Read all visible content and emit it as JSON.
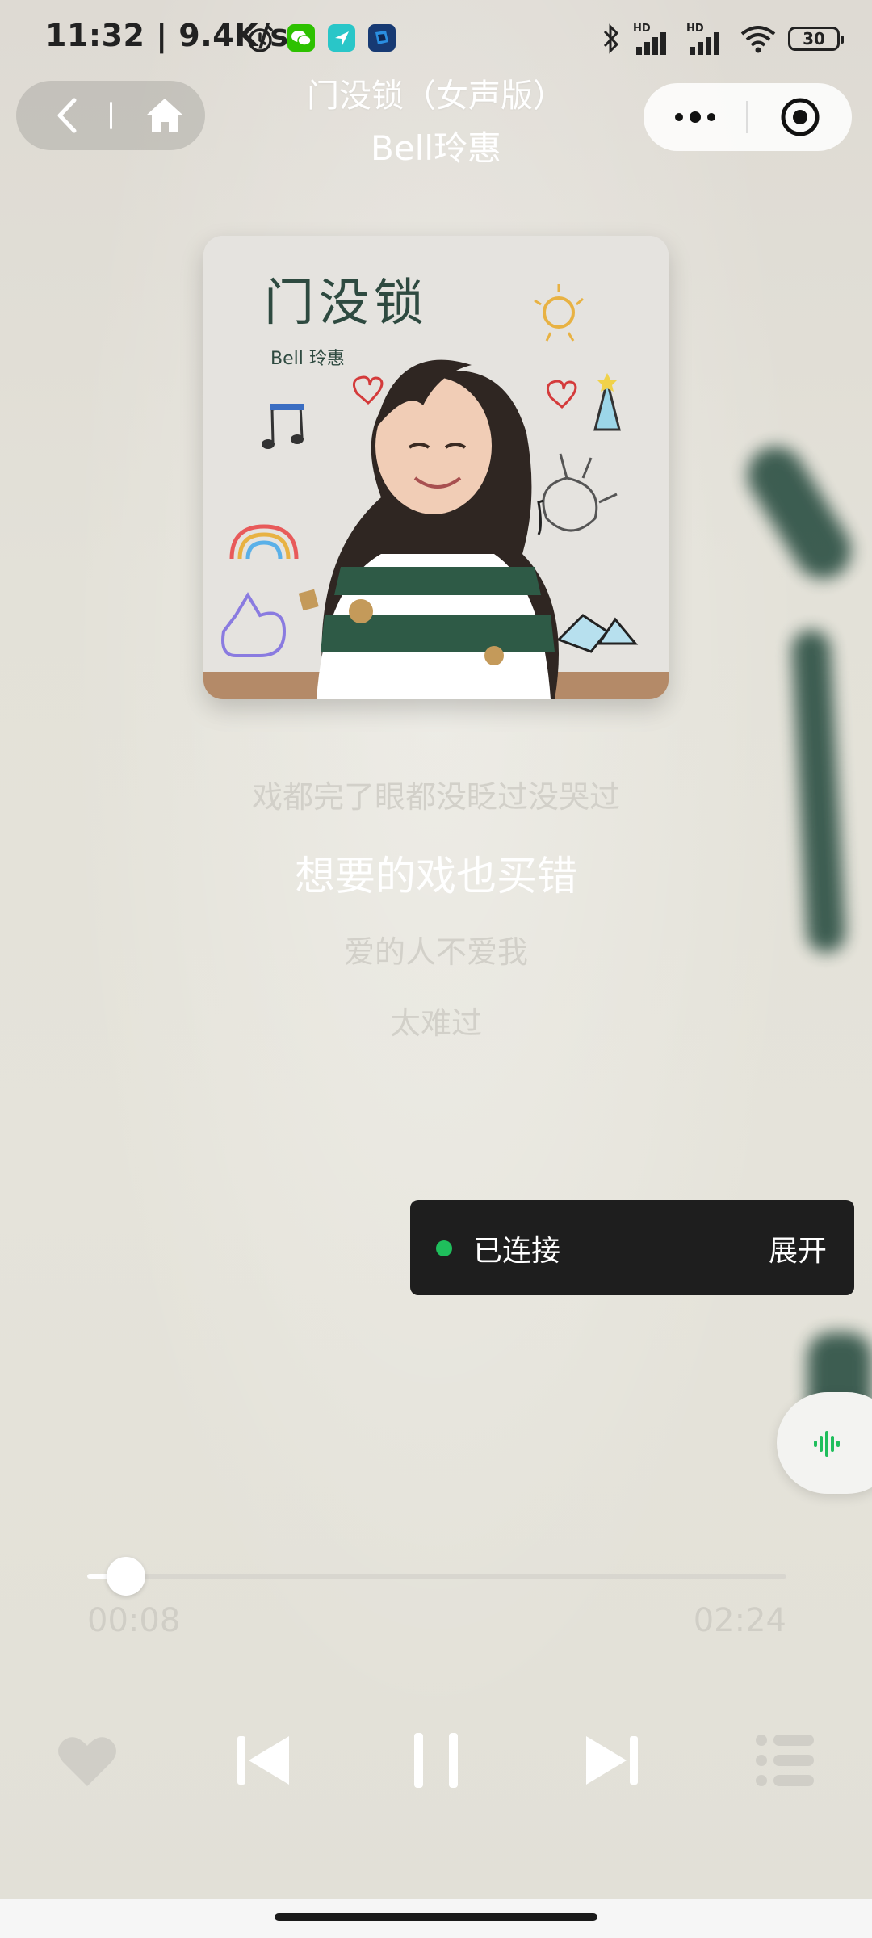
{
  "status_bar": {
    "time": "11:32",
    "net_speed": "| 9.4K/s",
    "battery": "30",
    "signal_label_1": "HD",
    "signal_label_2": "HD"
  },
  "header": {
    "title": "门没锁（女声版）",
    "artist": "Bell玲惠"
  },
  "cover": {
    "text_title": "门没锁",
    "text_artist": "Bell 玲惠"
  },
  "lyrics": {
    "previous": "戏都完了眼都没眨过没哭过",
    "current": "想要的戏也买错",
    "next_1": "爱的人不爱我",
    "next_2": "太难过"
  },
  "connection_toast": {
    "status": "已连接",
    "expand_label": "展开",
    "status_color": "#1fbe5c"
  },
  "player": {
    "elapsed": "00:08",
    "duration": "02:24",
    "progress_fraction": 0.056
  },
  "colors": {
    "accent_green": "#1fbe5c",
    "toast_bg": "#1e1e1e"
  },
  "icons": {
    "back": "chevron-left-icon",
    "home": "home-icon",
    "more": "more-dots-icon",
    "close": "target-close-icon",
    "voice": "voice-wave-icon",
    "like": "heart-icon",
    "prev": "skip-previous-icon",
    "pause": "pause-icon",
    "next": "skip-next-icon",
    "playlist": "playlist-icon"
  }
}
